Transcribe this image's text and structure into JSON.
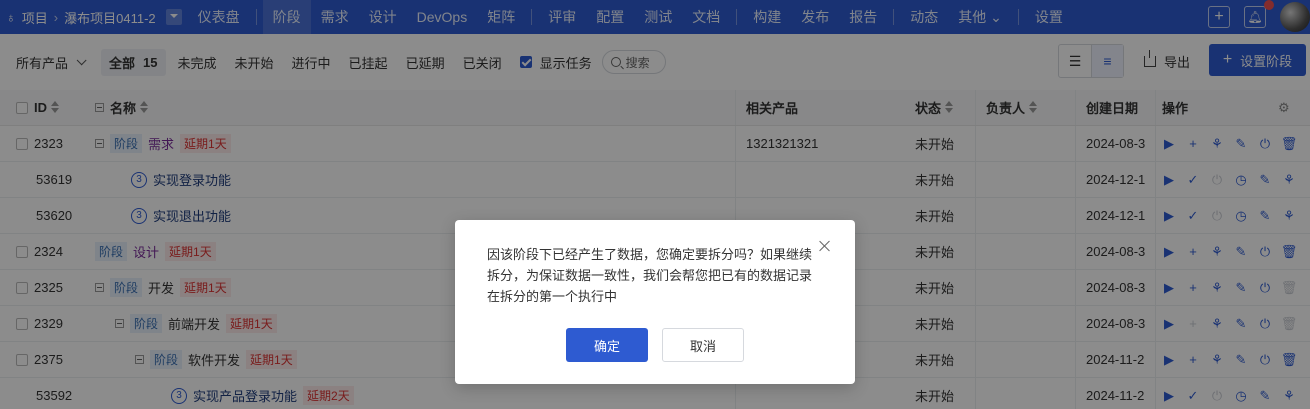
{
  "nav": {
    "project_label": "项目",
    "project_name": "瀑布项目0411-2",
    "items": [
      {
        "label": "仪表盘"
      },
      {
        "label": "阶段"
      },
      {
        "label": "需求"
      },
      {
        "label": "设计"
      },
      {
        "label": "DevOps"
      },
      {
        "label": "矩阵"
      },
      {
        "label": "评审"
      },
      {
        "label": "配置"
      },
      {
        "label": "测试"
      },
      {
        "label": "文档"
      },
      {
        "label": "构建"
      },
      {
        "label": "发布"
      },
      {
        "label": "报告"
      },
      {
        "label": "动态"
      },
      {
        "label": "其他"
      },
      {
        "label": "设置"
      }
    ],
    "active_index": 1,
    "accent": "#2e5bd1"
  },
  "filter": {
    "product_select": "所有产品",
    "all_label": "全部",
    "all_count": "15",
    "tabs": [
      "未完成",
      "未开始",
      "进行中",
      "已挂起",
      "已延期",
      "已关闭"
    ],
    "show_tasks_label": "显示任务",
    "search_label": "搜索",
    "export_label": "导出",
    "set_phase_label": "设置阶段"
  },
  "table": {
    "headers": {
      "id": "ID",
      "name": "名称",
      "product": "相关产品",
      "status": "状态",
      "owner": "负责人",
      "date": "创建日期",
      "ops": "操作"
    },
    "rows": [
      {
        "id": "2323",
        "type": "phase",
        "indent": 0,
        "collapse": true,
        "name": "需求",
        "delay": "延期1天",
        "product": "1321321321",
        "status": "未开始",
        "date": "2024-08-3"
      },
      {
        "id": "53619",
        "type": "task",
        "indent": 1,
        "name": "实现登录功能",
        "task_no": "3",
        "delay": "",
        "product": "",
        "status": "未开始",
        "date": "2024-12-1"
      },
      {
        "id": "53620",
        "type": "task",
        "indent": 1,
        "name": "实现退出功能",
        "task_no": "3",
        "delay": "",
        "product": "",
        "status": "未开始",
        "date": "2024-12-1"
      },
      {
        "id": "2324",
        "type": "phase",
        "indent": 0,
        "collapse": false,
        "name": "设计",
        "delay": "延期1天",
        "product": "",
        "status": "未开始",
        "date": "2024-08-3"
      },
      {
        "id": "2325",
        "type": "phase",
        "indent": 0,
        "collapse": true,
        "name": "开发",
        "delay": "延期1天",
        "product": "",
        "status": "未开始",
        "date": "2024-08-3"
      },
      {
        "id": "2329",
        "type": "phase",
        "indent": 1,
        "collapse": true,
        "name": "前端开发",
        "delay": "延期1天",
        "product": "",
        "status": "未开始",
        "date": "2024-08-3"
      },
      {
        "id": "2375",
        "type": "phase",
        "indent": 2,
        "collapse": true,
        "name": "软件开发",
        "delay": "延期1天",
        "product": "",
        "status": "未开始",
        "date": "2024-11-2"
      },
      {
        "id": "53592",
        "type": "task",
        "indent": 3,
        "name": "实现产品登录功能",
        "task_no": "3",
        "delay": "延期2天",
        "product": "",
        "status": "未开始",
        "date": "2024-11-2"
      }
    ],
    "phase_tag": "阶段"
  },
  "modal": {
    "message": "因该阶段下已经产生了数据，您确定要拆分吗？如果继续拆分，为保证数据一致性，我们会帮您把已有的数据记录在拆分的第一个执行中",
    "ok_label": "确定",
    "cancel_label": "取消"
  }
}
